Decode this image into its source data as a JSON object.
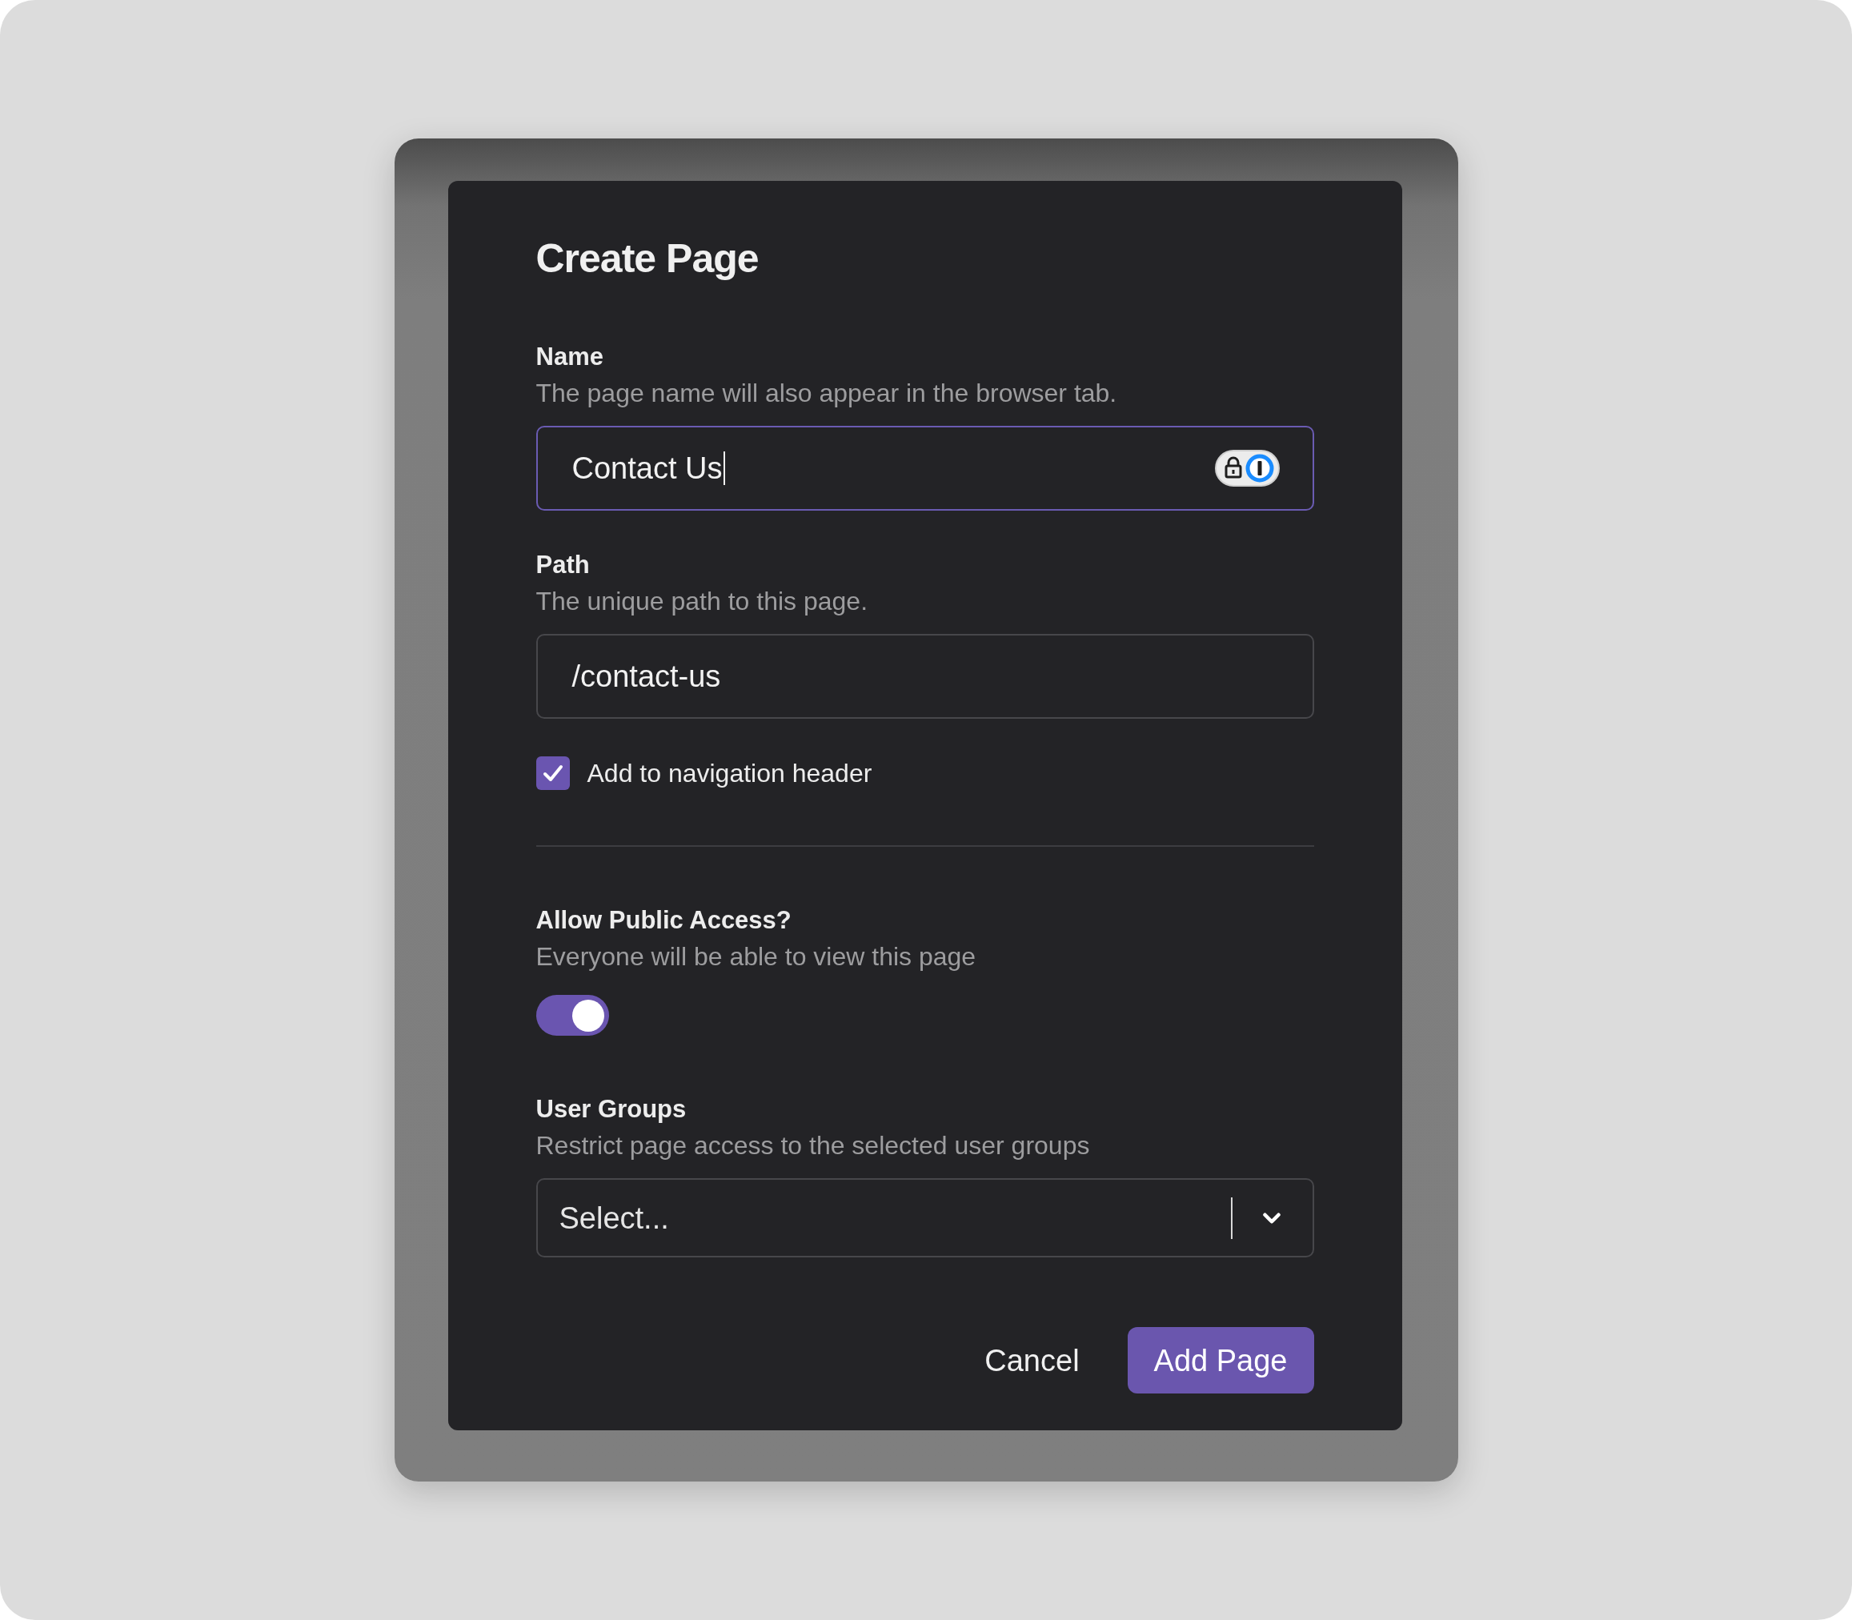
{
  "dialog": {
    "title": "Create Page"
  },
  "sections": [
    {
      "kind": "text_field",
      "label": "Name",
      "description": "The page name will also appear in the browser tab.",
      "value": "Contact Us",
      "focused": true
    },
    {
      "kind": "text_field",
      "label": "Path",
      "description": "The unique path to this page.",
      "value": "/contact-us",
      "focused": false
    },
    {
      "kind": "checkbox",
      "label": "Add to navigation header",
      "checked": true
    },
    {
      "kind": "divider"
    },
    {
      "kind": "switch",
      "label": "Allow Public Access?",
      "description": "Everyone will be able to view this page",
      "on": true
    },
    {
      "kind": "select",
      "label": "User Groups",
      "description": "Restrict page access to the selected user groups",
      "placeholder": "Select..."
    }
  ],
  "buttons": [
    {
      "label": "Cancel",
      "kind": "secondary"
    },
    {
      "label": "Add Page",
      "kind": "primary"
    }
  ]
}
